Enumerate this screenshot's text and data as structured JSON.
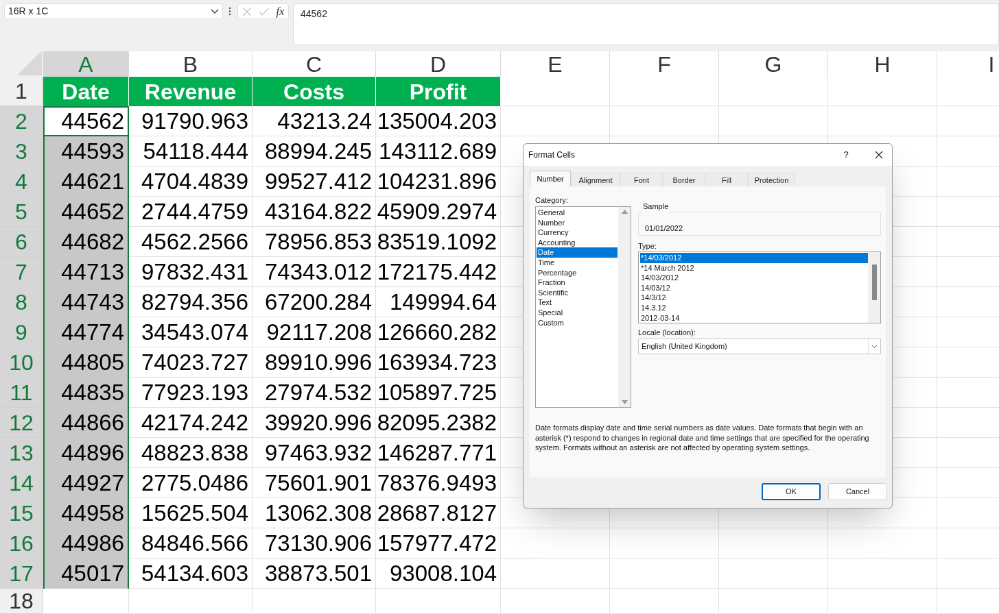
{
  "formula_bar": {
    "name_box": "16R x 1C",
    "fx": "fx",
    "value": "44562"
  },
  "sheet": {
    "columns": [
      {
        "label": "A",
        "selected": true
      },
      {
        "label": "B",
        "selected": false
      },
      {
        "label": "C",
        "selected": false
      },
      {
        "label": "D",
        "selected": false
      },
      {
        "label": "E",
        "selected": false
      },
      {
        "label": "F",
        "selected": false
      },
      {
        "label": "G",
        "selected": false
      },
      {
        "label": "H",
        "selected": false
      },
      {
        "label": "I",
        "selected": false
      }
    ],
    "header_row": {
      "number": "1",
      "selected": false,
      "cells": [
        "Date",
        "Revenue",
        "Costs",
        "Profit"
      ]
    },
    "rows": [
      {
        "number": "2",
        "selected": true,
        "active": true,
        "cells": [
          "44562",
          "91790.963",
          "43213.24",
          "135004.203"
        ]
      },
      {
        "number": "3",
        "selected": true,
        "active": false,
        "cells": [
          "44593",
          "54118.444",
          "88994.245",
          "143112.689"
        ]
      },
      {
        "number": "4",
        "selected": true,
        "active": false,
        "cells": [
          "44621",
          "4704.4839",
          "99527.412",
          "104231.896"
        ]
      },
      {
        "number": "5",
        "selected": true,
        "active": false,
        "cells": [
          "44652",
          "2744.4759",
          "43164.822",
          "45909.2974"
        ]
      },
      {
        "number": "6",
        "selected": true,
        "active": false,
        "cells": [
          "44682",
          "4562.2566",
          "78956.853",
          "83519.1092"
        ]
      },
      {
        "number": "7",
        "selected": true,
        "active": false,
        "cells": [
          "44713",
          "97832.431",
          "74343.012",
          "172175.442"
        ]
      },
      {
        "number": "8",
        "selected": true,
        "active": false,
        "cells": [
          "44743",
          "82794.356",
          "67200.284",
          "149994.64"
        ]
      },
      {
        "number": "9",
        "selected": true,
        "active": false,
        "cells": [
          "44774",
          "34543.074",
          "92117.208",
          "126660.282"
        ]
      },
      {
        "number": "10",
        "selected": true,
        "active": false,
        "cells": [
          "44805",
          "74023.727",
          "89910.996",
          "163934.723"
        ]
      },
      {
        "number": "11",
        "selected": true,
        "active": false,
        "cells": [
          "44835",
          "77923.193",
          "27974.532",
          "105897.725"
        ]
      },
      {
        "number": "12",
        "selected": true,
        "active": false,
        "cells": [
          "44866",
          "42174.242",
          "39920.996",
          "82095.2382"
        ]
      },
      {
        "number": "13",
        "selected": true,
        "active": false,
        "cells": [
          "44896",
          "48823.838",
          "97463.932",
          "146287.771"
        ]
      },
      {
        "number": "14",
        "selected": true,
        "active": false,
        "cells": [
          "44927",
          "2775.0486",
          "75601.901",
          "78376.9493"
        ]
      },
      {
        "number": "15",
        "selected": true,
        "active": false,
        "cells": [
          "44958",
          "15625.504",
          "13062.308",
          "28687.8127"
        ]
      },
      {
        "number": "16",
        "selected": true,
        "active": false,
        "cells": [
          "44986",
          "84846.566",
          "73130.906",
          "157977.472"
        ]
      },
      {
        "number": "17",
        "selected": true,
        "active": false,
        "cells": [
          "45017",
          "54134.603",
          "38873.501",
          "93008.104"
        ]
      },
      {
        "number": "18",
        "selected": false,
        "cells": []
      }
    ]
  },
  "dialog": {
    "title": "Format Cells",
    "help": "?",
    "tabs": [
      {
        "label": "Number",
        "selected": true
      },
      {
        "label": "Alignment",
        "selected": false
      },
      {
        "label": "Font",
        "selected": false
      },
      {
        "label": "Border",
        "selected": false
      },
      {
        "label": "Fill",
        "selected": false
      },
      {
        "label": "Protection",
        "selected": false
      }
    ],
    "category_label": "Category:",
    "categories": [
      {
        "label": "General",
        "selected": false
      },
      {
        "label": "Number",
        "selected": false
      },
      {
        "label": "Currency",
        "selected": false
      },
      {
        "label": "Accounting",
        "selected": false
      },
      {
        "label": "Date",
        "selected": true
      },
      {
        "label": "Time",
        "selected": false
      },
      {
        "label": "Percentage",
        "selected": false
      },
      {
        "label": "Fraction",
        "selected": false
      },
      {
        "label": "Scientific",
        "selected": false
      },
      {
        "label": "Text",
        "selected": false
      },
      {
        "label": "Special",
        "selected": false
      },
      {
        "label": "Custom",
        "selected": false
      }
    ],
    "sample_label": "Sample",
    "sample_value": "01/01/2022",
    "type_label": "Type:",
    "types": [
      {
        "label": "*14/03/2012",
        "selected": true
      },
      {
        "label": "*14 March 2012",
        "selected": false
      },
      {
        "label": "14/03/2012",
        "selected": false
      },
      {
        "label": "14/03/12",
        "selected": false
      },
      {
        "label": "14/3/12",
        "selected": false
      },
      {
        "label": "14.3.12",
        "selected": false
      },
      {
        "label": "2012-03-14",
        "selected": false
      }
    ],
    "locale_label": "Locale (location):",
    "locale_value": "English (United Kingdom)",
    "description": "Date formats display date and time serial numbers as date values.  Date formats that begin with an asterisk (*) respond to changes in regional date and time settings that are specified for the operating system. Formats without an asterisk are not affected by operating system settings.",
    "buttons": [
      {
        "label": "OK",
        "kind": "default"
      },
      {
        "label": "Cancel",
        "kind": "normal"
      }
    ]
  }
}
